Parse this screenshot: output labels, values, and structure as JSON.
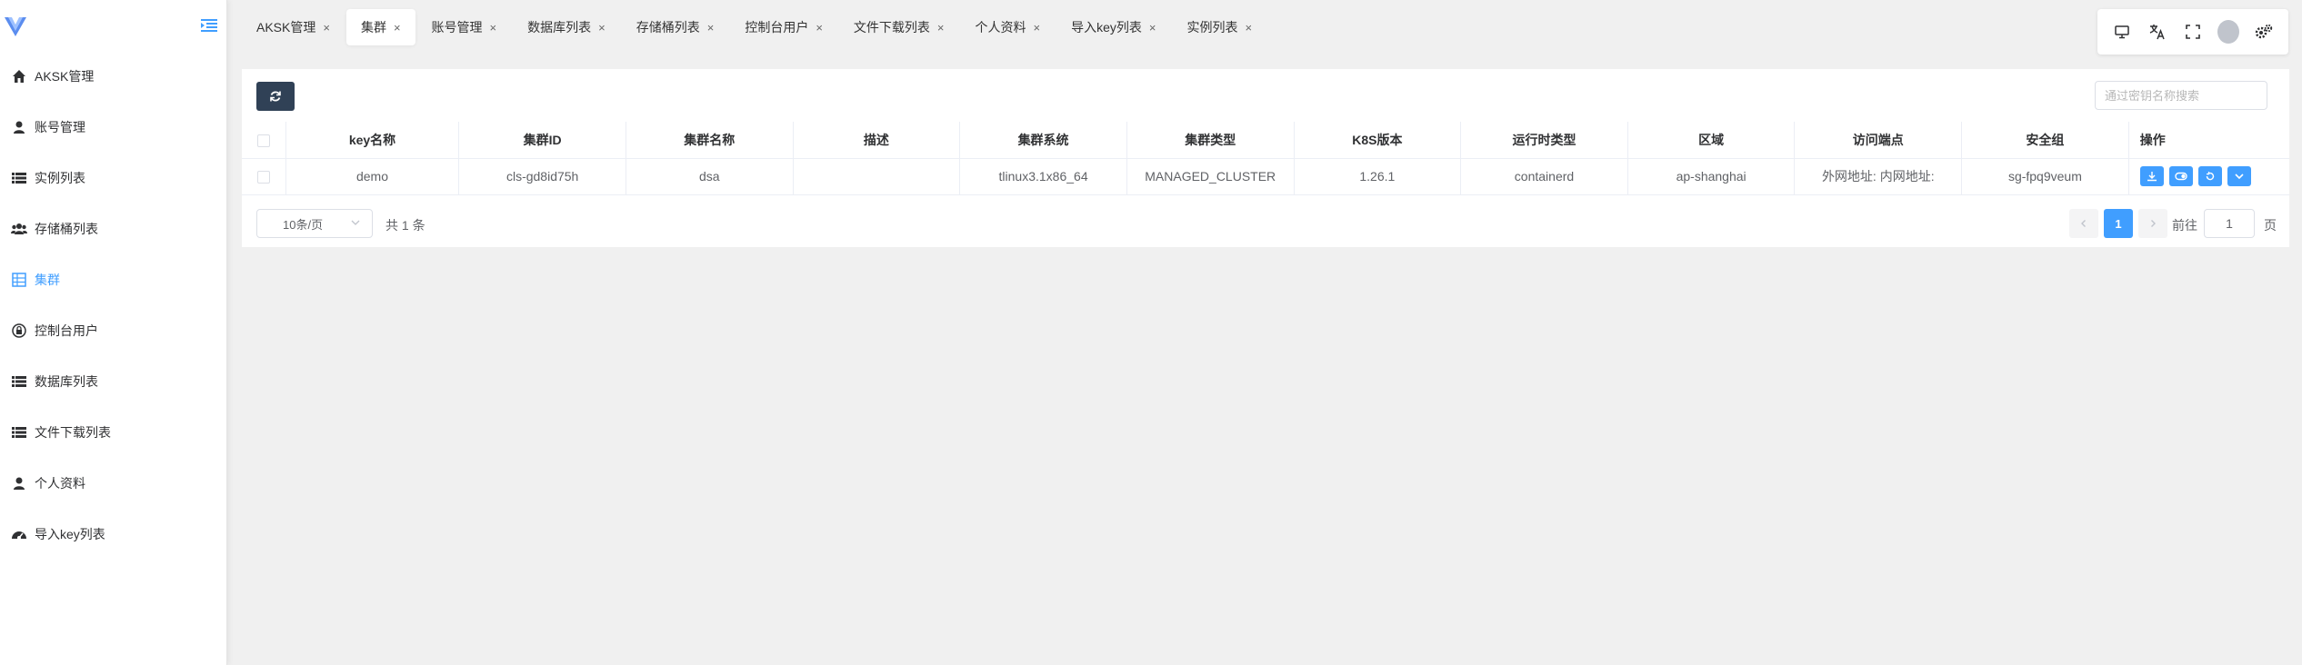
{
  "sidebar": {
    "items": [
      {
        "label": "AKSK管理",
        "icon": "home-icon"
      },
      {
        "label": "账号管理",
        "icon": "user-icon"
      },
      {
        "label": "实例列表",
        "icon": "list-icon"
      },
      {
        "label": "存储桶列表",
        "icon": "users-icon"
      },
      {
        "label": "集群",
        "icon": "grid-icon",
        "active": true
      },
      {
        "label": "控制台用户",
        "icon": "lock-icon"
      },
      {
        "label": "数据库列表",
        "icon": "list-icon"
      },
      {
        "label": "文件下载列表",
        "icon": "list-icon"
      },
      {
        "label": "个人资料",
        "icon": "user-icon"
      },
      {
        "label": "导入key列表",
        "icon": "dashboard-icon"
      }
    ]
  },
  "tabs": [
    {
      "label": "AKSK管理"
    },
    {
      "label": "集群",
      "active": true
    },
    {
      "label": "账号管理"
    },
    {
      "label": "数据库列表"
    },
    {
      "label": "存储桶列表"
    },
    {
      "label": "控制台用户"
    },
    {
      "label": "文件下载列表"
    },
    {
      "label": "个人资料"
    },
    {
      "label": "导入key列表"
    },
    {
      "label": "实例列表"
    }
  ],
  "tab_close_glyph": "×",
  "search": {
    "placeholder": "通过密钥名称搜索"
  },
  "table": {
    "columns": [
      "key名称",
      "集群ID",
      "集群名称",
      "描述",
      "集群系统",
      "集群类型",
      "K8S版本",
      "运行时类型",
      "区域",
      "访问端点",
      "安全组",
      "操作"
    ],
    "rows": [
      [
        "demo",
        "cls-gd8id75h",
        "dsa",
        "",
        "tlinux3.1x86_64",
        "MANAGED_CLUSTER",
        "1.26.1",
        "containerd",
        "ap-shanghai",
        "外网地址: 内网地址:",
        "sg-fpq9veum"
      ]
    ]
  },
  "pagination": {
    "page_size": "10条/页",
    "total": "共 1 条",
    "current_page": "1",
    "goto_label": "前往",
    "goto_value": "1",
    "page_suffix": "页"
  },
  "colors": {
    "primary": "#409eff",
    "refresh_button": "#304156"
  }
}
